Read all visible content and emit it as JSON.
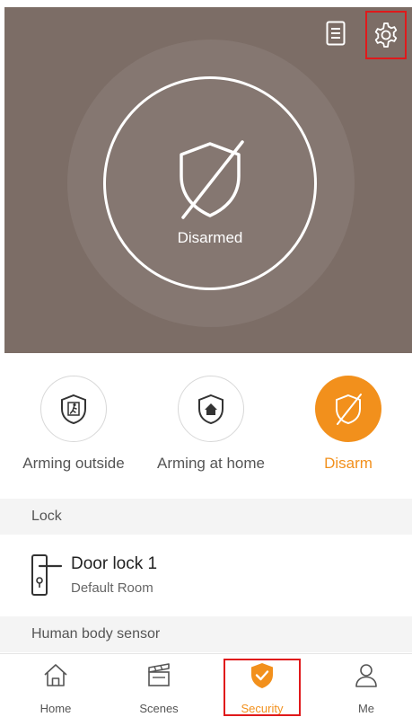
{
  "status": {
    "label": "Disarmed"
  },
  "header": {
    "log_icon": "document-icon",
    "settings_icon": "gear-icon"
  },
  "modes": [
    {
      "label": "Arming outside",
      "icon": "person-exit-shield-icon",
      "active": false
    },
    {
      "label": "Arming at home",
      "icon": "home-shield-icon",
      "active": false
    },
    {
      "label": "Disarm",
      "icon": "shield-slash-icon",
      "active": true
    }
  ],
  "sections": [
    {
      "title": "Lock",
      "devices": [
        {
          "name": "Door lock 1",
          "room": "Default Room",
          "icon": "door-lock-icon"
        }
      ]
    },
    {
      "title": "Human body sensor",
      "devices": []
    }
  ],
  "tabbar": {
    "items": [
      {
        "label": "Home",
        "icon": "home-icon"
      },
      {
        "label": "Scenes",
        "icon": "clapperboard-icon"
      },
      {
        "label": "Security",
        "icon": "shield-check-icon",
        "active": true
      },
      {
        "label": "Me",
        "icon": "person-icon"
      }
    ]
  },
  "colors": {
    "hero_bg": "#7c6d66",
    "accent": "#f2901c",
    "highlight": "#e0191b"
  }
}
